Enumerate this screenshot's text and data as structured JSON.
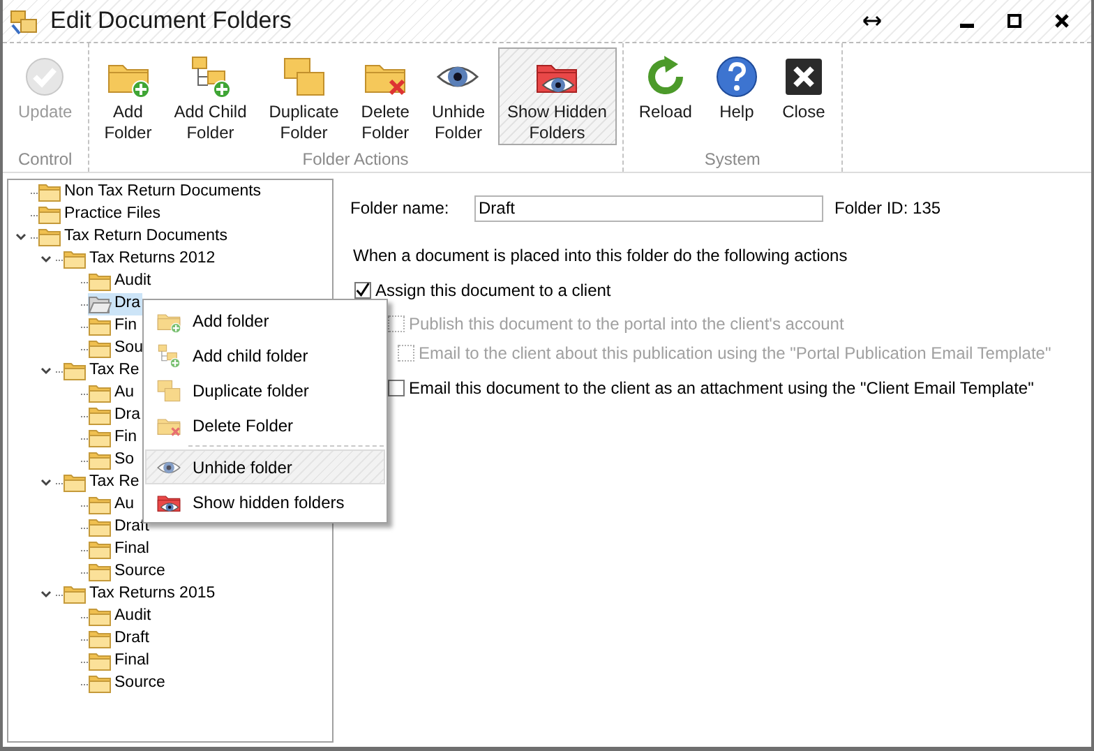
{
  "window": {
    "title": "Edit Document Folders"
  },
  "ribbon": {
    "groups": [
      {
        "label": "Control",
        "buttons": [
          {
            "label": "Update",
            "kind": "check",
            "disabled": true,
            "selected": false
          }
        ]
      },
      {
        "label": "Folder Actions",
        "buttons": [
          {
            "label": "Add\nFolder",
            "kind": "folder-plus",
            "disabled": false,
            "selected": false
          },
          {
            "label": "Add Child\nFolder",
            "kind": "child-plus",
            "disabled": false,
            "selected": false
          },
          {
            "label": "Duplicate\nFolder",
            "kind": "folders",
            "disabled": false,
            "selected": false
          },
          {
            "label": "Delete\nFolder",
            "kind": "folder-x",
            "disabled": false,
            "selected": false
          },
          {
            "label": "Unhide\nFolder",
            "kind": "eye",
            "disabled": false,
            "selected": false
          },
          {
            "label": "Show Hidden\nFolders",
            "kind": "red-eye",
            "disabled": false,
            "selected": true
          }
        ]
      },
      {
        "label": "System",
        "buttons": [
          {
            "label": "Reload",
            "kind": "reload",
            "disabled": false,
            "selected": false
          },
          {
            "label": "Help",
            "kind": "help",
            "disabled": false,
            "selected": false
          },
          {
            "label": "Close",
            "kind": "close",
            "disabled": false,
            "selected": false
          }
        ]
      }
    ]
  },
  "tree": [
    {
      "label": "Non Tax Return Documents",
      "selected": false
    },
    {
      "label": "Practice Files",
      "selected": false
    },
    {
      "label": "Tax Return Documents",
      "selected": false,
      "expanded": true,
      "children": [
        {
          "label": "Tax Returns 2012",
          "selected": false,
          "expanded": true,
          "children": [
            {
              "label": "Audit",
              "selected": false
            },
            {
              "label": "Dra",
              "selected": true
            },
            {
              "label": "Fin",
              "selected": false
            },
            {
              "label": "Sou",
              "selected": false
            }
          ]
        },
        {
          "label": "Tax Re",
          "selected": false,
          "expanded": true,
          "children": [
            {
              "label": "Au",
              "selected": false
            },
            {
              "label": "Dra",
              "selected": false
            },
            {
              "label": "Fin",
              "selected": false
            },
            {
              "label": "So",
              "selected": false
            }
          ]
        },
        {
          "label": "Tax Re",
          "selected": false,
          "expanded": true,
          "children": [
            {
              "label": "Au",
              "selected": false
            },
            {
              "label": "Draft",
              "selected": false
            },
            {
              "label": "Final",
              "selected": false
            },
            {
              "label": "Source",
              "selected": false
            }
          ]
        },
        {
          "label": "Tax Returns 2015",
          "selected": false,
          "expanded": true,
          "children": [
            {
              "label": "Audit",
              "selected": false
            },
            {
              "label": "Draft",
              "selected": false
            },
            {
              "label": "Final",
              "selected": false
            },
            {
              "label": "Source",
              "selected": false
            }
          ]
        }
      ]
    }
  ],
  "details": {
    "folder_name_label": "Folder name:",
    "folder_name": "Draft",
    "folder_id": "Folder ID: 135",
    "intro": "When a document is placed into this folder do the following actions",
    "options": [
      {
        "label": "Assign this document to a client",
        "checked": true,
        "disabled": false
      },
      {
        "label": "Publish this document to the portal into the client's account",
        "checked": false,
        "disabled": true
      },
      {
        "label": "Email to the client about this publication using the \"Portal Publication Email Template\"",
        "checked": false,
        "disabled": true
      },
      {
        "label": "Email this document to the client as an attachment using the \"Client Email Template\"",
        "checked": false,
        "disabled": false
      }
    ]
  },
  "context_menu": [
    {
      "kind": "folder-plus",
      "label": "Add folder",
      "selected": false
    },
    {
      "kind": "child-plus",
      "label": "Add child folder",
      "selected": false
    },
    {
      "kind": "folders",
      "label": "Duplicate folder",
      "selected": false
    },
    {
      "kind": "folder-x",
      "label": "Delete Folder",
      "selected": false
    },
    {
      "kind": "eye",
      "label": "Unhide folder",
      "selected": true
    },
    {
      "kind": "red-eye",
      "label": "Show hidden folders",
      "selected": false
    }
  ]
}
